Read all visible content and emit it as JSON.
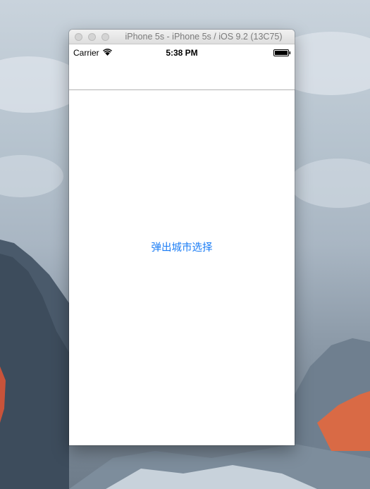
{
  "window": {
    "title": "iPhone 5s - iPhone 5s / iOS 9.2 (13C75)"
  },
  "status_bar": {
    "carrier": "Carrier",
    "time": "5:38 PM",
    "wifi_icon": "wifi-icon",
    "battery_icon": "battery-icon"
  },
  "main": {
    "button_label": "弹出城市选择"
  },
  "colors": {
    "accent": "#1a7cf5",
    "background": "#ffffff",
    "separator": "#b2b2b2"
  }
}
